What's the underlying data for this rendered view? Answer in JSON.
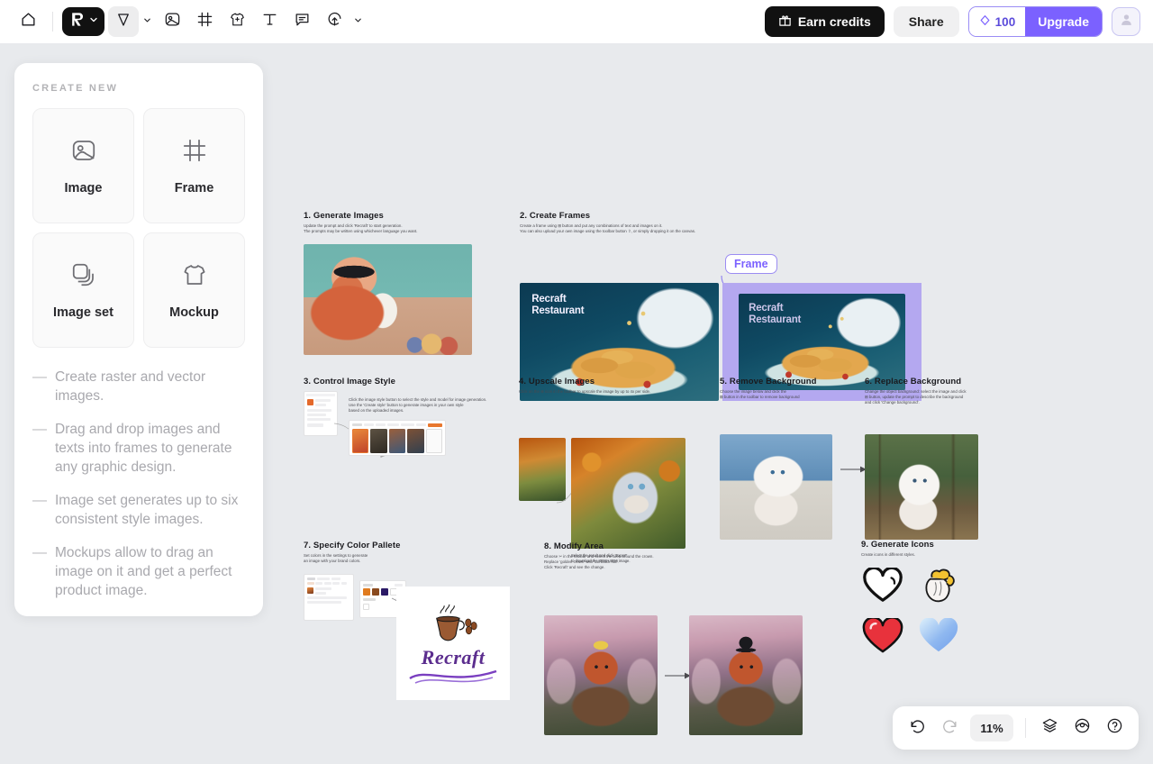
{
  "app": {
    "name": "Recraft",
    "canvas_bg": "#e8eaed",
    "accent": "#7b61ff"
  },
  "toolbar": {
    "home_icon": "home-icon",
    "logo_icon": "recraft-logo-icon",
    "logo_caret": "chevron-down-icon",
    "select_icon": "cursor-select-icon",
    "select_caret": "chevron-down-icon",
    "image_icon": "image-icon",
    "frame_icon": "frame-icon",
    "mockup_icon": "tshirt-mockup-icon",
    "text_icon": "text-icon",
    "comment_icon": "comment-icon",
    "upload_icon": "upload-image-icon",
    "upload_caret": "chevron-down-icon",
    "earn_credits_label": "Earn credits",
    "earn_credits_icon": "gift-icon",
    "share_label": "Share",
    "credits_value": "100",
    "credits_icon": "diamond-icon",
    "upgrade_label": "Upgrade",
    "avatar_icon": "user-avatar-icon"
  },
  "sidebar": {
    "title": "CREATE NEW",
    "cards": [
      {
        "label": "Image",
        "icon": "image-icon"
      },
      {
        "label": "Frame",
        "icon": "frame-icon"
      },
      {
        "label": "Image set",
        "icon": "image-stack-icon"
      },
      {
        "label": "Mockup",
        "icon": "tshirt-icon"
      }
    ],
    "bullets": [
      "Create raster and vector images.",
      "Drag and drop images and texts into frames to generate any graphic design.",
      "Image set generates up to six consistent style images.",
      "Mockups allow to drag an image on it and get a perfect product image."
    ]
  },
  "canvas": {
    "sections": [
      {
        "id": 1,
        "title": "1. Generate Images",
        "desc": "Update the prompt and click 'Recraft' to start generation.\nThe prompts may be written using whichever language you want."
      },
      {
        "id": 2,
        "title": "2. Create Frames",
        "desc": "Create a frame using ⊞ button and put any combinations of text and images on it.\nYou can also upload your own image using the toolbar button ⇧, or simply dropping it on the canvas.",
        "frame_badge": "Frame",
        "image_text_line1": "Recraft",
        "image_text_line2": "Restaurant"
      },
      {
        "id": 3,
        "title": "3. Control Image Style",
        "desc": "Click the image style button to select the style and model for image generation.\nUse the 'Create style' button to generate images in your own style\nbased on the uploaded images.",
        "create_style_button": "Create style"
      },
      {
        "id": 4,
        "title": "4. Upscale Images",
        "desc": "Click on the ⊕ icon in the toolbar to upscale the image by up to 4x per side.",
        "caption": "Select the result and click 'Export'\nto download the 4096×4096 image."
      },
      {
        "id": 5,
        "title": "5. Remove Background",
        "desc": "Choose the image below and click the\n⊠ button in the toolbar to remove background"
      },
      {
        "id": 6,
        "title": "6. Replace Background",
        "desc": "Change the object background: select the image and click\n⊞ button, update the prompt to describe the background\nand click 'Change background'."
      },
      {
        "id": 7,
        "title": "7. Specify Color Pallete",
        "desc": "Set colors in the settings to generate\nan image with your brand colors.",
        "logo_text": "Recraft",
        "prompt_text": "Coffee themed logo for a company called 'Recraft'",
        "palette": [
          "#e07b1f",
          "#8a4a1e",
          "#2b1a66"
        ],
        "panel_labels": [
          "Colors",
          "Background"
        ]
      },
      {
        "id": 8,
        "title": "8. Modify Area",
        "desc": "Choose ✂ in the toolbar and select the area around the crown.\nReplace 'golden crown' with 'tall black hat'.\nClick 'Recraft' and see the change."
      },
      {
        "id": 9,
        "title": "9. Generate Icons",
        "desc": "Create icons in different styles.",
        "icons": [
          {
            "name": "heart-outline-icon",
            "style": "outline"
          },
          {
            "name": "heart-anatomical-icon",
            "style": "anatomical"
          },
          {
            "name": "heart-red-icon",
            "style": "glossy-red"
          },
          {
            "name": "heart-blue-icon",
            "style": "gradient-blue"
          }
        ]
      }
    ]
  },
  "bottombar": {
    "undo_icon": "undo-icon",
    "redo_icon": "redo-icon",
    "zoom_level": "11%",
    "layers_icon": "layers-icon",
    "preview_icon": "eye-preview-icon",
    "help_icon": "help-question-icon"
  }
}
